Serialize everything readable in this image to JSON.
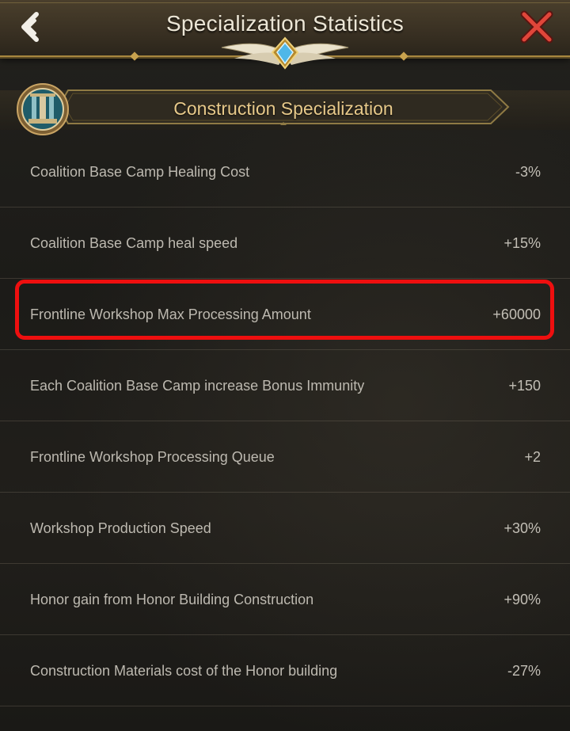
{
  "header": {
    "title": "Specialization Statistics",
    "back_icon": "back-arrow-icon",
    "close_icon": "close-x-icon"
  },
  "section": {
    "title": "Construction Specialization",
    "badge_icon": "construction-badge-icon"
  },
  "stats": [
    {
      "label": "Coalition Base Camp Healing Cost",
      "value": "-3%"
    },
    {
      "label": "Coalition Base Camp heal speed",
      "value": "+15%"
    },
    {
      "label": "Frontline Workshop Max Processing Amount",
      "value": "+60000"
    },
    {
      "label": "Each Coalition Base Camp increase Bonus Immunity",
      "value": "+150"
    },
    {
      "label": "Frontline Workshop Processing Queue",
      "value": "+2"
    },
    {
      "label": "Workshop Production Speed",
      "value": "+30%"
    },
    {
      "label": "Honor gain from Honor Building Construction",
      "value": "+90%"
    },
    {
      "label": "Construction Materials cost of the Honor building",
      "value": "-27%"
    }
  ],
  "highlighted_row": 2,
  "colors": {
    "accent_gold": "#c8a24e",
    "highlight_red": "#ee0f0f",
    "close_red": "#e0463a"
  }
}
